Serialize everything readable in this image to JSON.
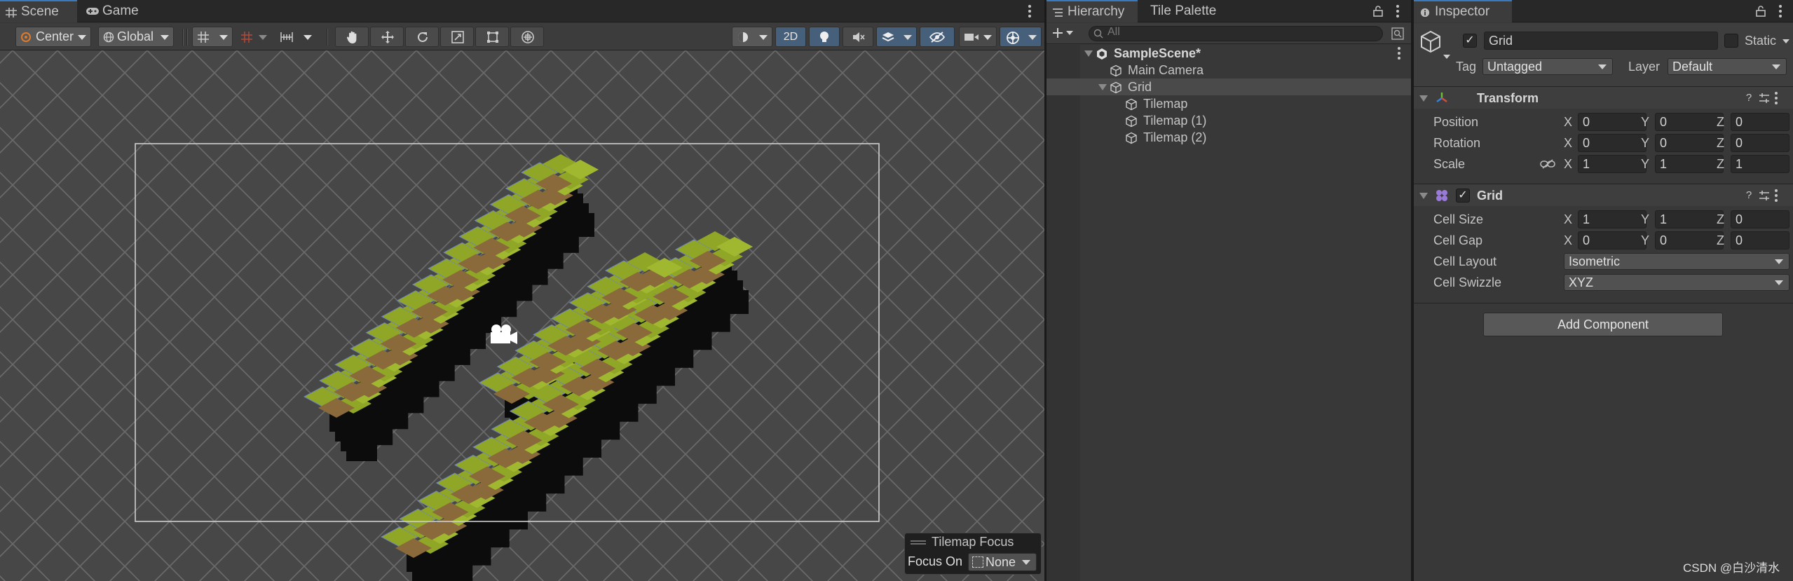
{
  "scene_tabs": [
    {
      "label": "Scene",
      "icon": "grid-icon",
      "active": true
    },
    {
      "label": "Game",
      "icon": "gamepad-icon",
      "active": false
    }
  ],
  "scene_toolbar": {
    "pivot_mode": "Center",
    "pivot_rotation": "Global",
    "mode_2d": "2D"
  },
  "tilemap_focus": {
    "title": "Tilemap Focus",
    "focus_on_label": "Focus On",
    "focus_on_value": "None"
  },
  "hierarchy": {
    "tabs": [
      {
        "label": "Hierarchy",
        "active": true
      },
      {
        "label": "Tile Palette",
        "active": false
      }
    ],
    "search_placeholder": "All",
    "items": [
      {
        "label": "SampleScene*",
        "depth": 0,
        "expanded": true,
        "type": "scene"
      },
      {
        "label": "Main Camera",
        "depth": 1,
        "type": "gameobject"
      },
      {
        "label": "Grid",
        "depth": 1,
        "expanded": true,
        "selected": true,
        "type": "gameobject"
      },
      {
        "label": "Tilemap",
        "depth": 2,
        "type": "gameobject"
      },
      {
        "label": "Tilemap (1)",
        "depth": 2,
        "type": "gameobject"
      },
      {
        "label": "Tilemap (2)",
        "depth": 2,
        "type": "gameobject"
      }
    ]
  },
  "inspector": {
    "tab": "Inspector",
    "object_name": "Grid",
    "static_label": "Static",
    "tag_label": "Tag",
    "tag_value": "Untagged",
    "layer_label": "Layer",
    "layer_value": "Default",
    "transform": {
      "title": "Transform",
      "position_label": "Position",
      "rotation_label": "Rotation",
      "scale_label": "Scale",
      "position": {
        "x": "0",
        "y": "0",
        "z": "0"
      },
      "rotation": {
        "x": "0",
        "y": "0",
        "z": "0"
      },
      "scale": {
        "x": "1",
        "y": "1",
        "z": "1"
      }
    },
    "grid": {
      "title": "Grid",
      "cell_size_label": "Cell Size",
      "cell_gap_label": "Cell Gap",
      "cell_layout_label": "Cell Layout",
      "cell_swizzle_label": "Cell Swizzle",
      "cell_size": {
        "x": "1",
        "y": "1",
        "z": "0"
      },
      "cell_gap": {
        "x": "0",
        "y": "0",
        "z": "0"
      },
      "cell_layout": "Isometric",
      "cell_swizzle": "XYZ"
    },
    "axis_labels": {
      "x": "X",
      "y": "Y",
      "z": "Z"
    },
    "add_component": "Add Component"
  },
  "watermark": "CSDN @白沙清水",
  "colors": {
    "accent_blue": "#3a79bb",
    "grass": "#8fa626",
    "dirt": "#8a6a3a",
    "shadow": "#0c0c0c"
  }
}
